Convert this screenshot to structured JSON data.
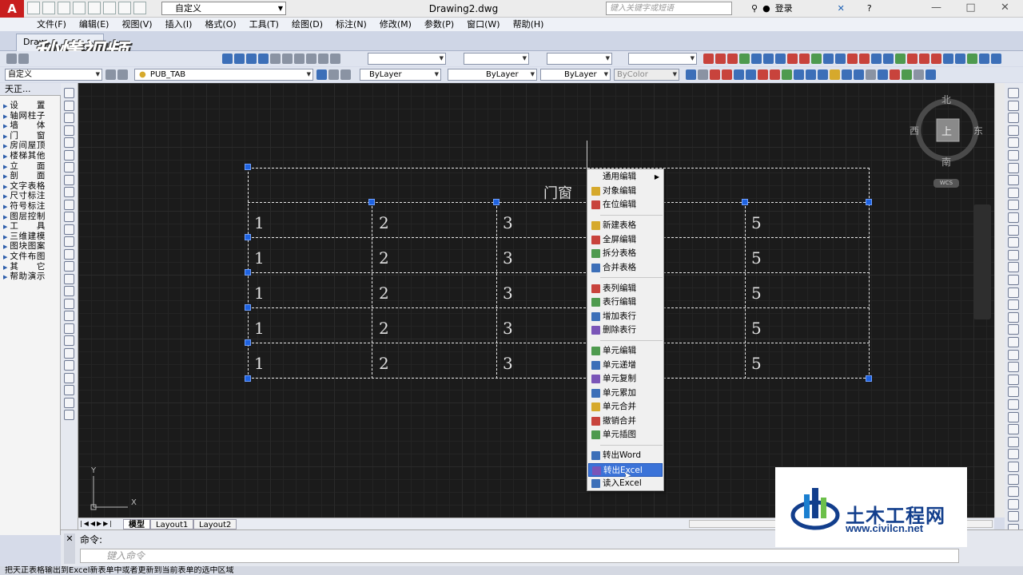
{
  "titlebar": {
    "workspace": "自定义",
    "document_title": "Drawing2.dwg",
    "search_placeholder": "键入关键字或短语",
    "login_label": "登录"
  },
  "menu": [
    "文件(F)",
    "编辑(E)",
    "视图(V)",
    "插入(I)",
    "格式(O)",
    "工具(T)",
    "绘图(D)",
    "标注(N)",
    "修改(M)",
    "参数(P)",
    "窗口(W)",
    "帮助(H)"
  ],
  "tabs": {
    "document_tab": "Draw"
  },
  "watermark": "秒懂视频",
  "toolbar2": {
    "style_combo": "自定义",
    "layer_combo": "PUB_TAB",
    "color_combo": "ByLayer",
    "linetype_combo": "ByLayer",
    "lineweight_combo": "ByLayer",
    "plotstyle_combo": "ByColor"
  },
  "left_panel": {
    "title": "天正...",
    "items": [
      "设　　置",
      "轴网柱子",
      "墙　　体",
      "门　　窗",
      "房间屋顶",
      "楼梯其他",
      "立　　面",
      "剖　　面",
      "文字表格",
      "尺寸标注",
      "符号标注",
      "图层控制",
      "工　　具",
      "三维建模",
      "图块图案",
      "文件布图",
      "其　　它",
      "帮助演示"
    ]
  },
  "drawing_table": {
    "title": "门窗",
    "rows": [
      [
        "1",
        "2",
        "3",
        "",
        "5"
      ],
      [
        "1",
        "2",
        "3",
        "",
        "5"
      ],
      [
        "1",
        "2",
        "3",
        "",
        "5"
      ],
      [
        "1",
        "2",
        "3",
        "",
        "5"
      ],
      [
        "1",
        "2",
        "3",
        "",
        "5"
      ]
    ]
  },
  "compass": {
    "north": "北",
    "south": "南",
    "east": "东",
    "west": "西",
    "top": "上",
    "ucs": "WCS"
  },
  "ucs_icon": {
    "x_label": "X",
    "y_label": "Y"
  },
  "context_menu": {
    "groups": [
      [
        {
          "label": "通用编辑",
          "icon": "none",
          "submenu": true
        },
        {
          "label": "对象编辑",
          "icon": "edit-icon"
        },
        {
          "label": "在位编辑",
          "icon": "inplace-edit-icon"
        }
      ],
      [
        {
          "label": "新建表格",
          "icon": "new-table-icon"
        },
        {
          "label": "全屏编辑",
          "icon": "fullscreen-edit-icon"
        },
        {
          "label": "拆分表格",
          "icon": "split-table-icon"
        },
        {
          "label": "合并表格",
          "icon": "merge-table-icon"
        }
      ],
      [
        {
          "label": "表列编辑",
          "icon": "column-edit-icon"
        },
        {
          "label": "表行编辑",
          "icon": "row-edit-icon"
        },
        {
          "label": "增加表行",
          "icon": "add-row-icon"
        },
        {
          "label": "删除表行",
          "icon": "delete-row-icon"
        }
      ],
      [
        {
          "label": "单元编辑",
          "icon": "cell-edit-icon"
        },
        {
          "label": "单元递增",
          "icon": "cell-increment-icon"
        },
        {
          "label": "单元复制",
          "icon": "cell-copy-icon"
        },
        {
          "label": "单元累加",
          "icon": "cell-sum-icon"
        },
        {
          "label": "单元合并",
          "icon": "cell-merge-icon"
        },
        {
          "label": "撤销合并",
          "icon": "undo-merge-icon"
        },
        {
          "label": "单元插图",
          "icon": "cell-image-icon"
        }
      ],
      [
        {
          "label": "转出Word",
          "icon": "word-export-icon"
        },
        {
          "label": "转出Excel",
          "icon": "excel-export-icon",
          "highlighted": true
        },
        {
          "label": "读入Excel",
          "icon": "excel-import-icon"
        }
      ]
    ]
  },
  "layout_tabs": [
    "模型",
    "Layout1",
    "Layout2"
  ],
  "command": {
    "history": "命令:",
    "input_placeholder": "键入命令"
  },
  "status_text": "把天正表格输出到Excel新表单中或者更新到当前表单的选中区域",
  "site_logo": {
    "name": "土木工程网",
    "url": "www.civilcn.net"
  },
  "colors": {
    "canvas": "#1b1b1b",
    "grip": "#1f63e0",
    "menu_highlight": "#3b73d8",
    "logo_red": "#c81e1e"
  }
}
